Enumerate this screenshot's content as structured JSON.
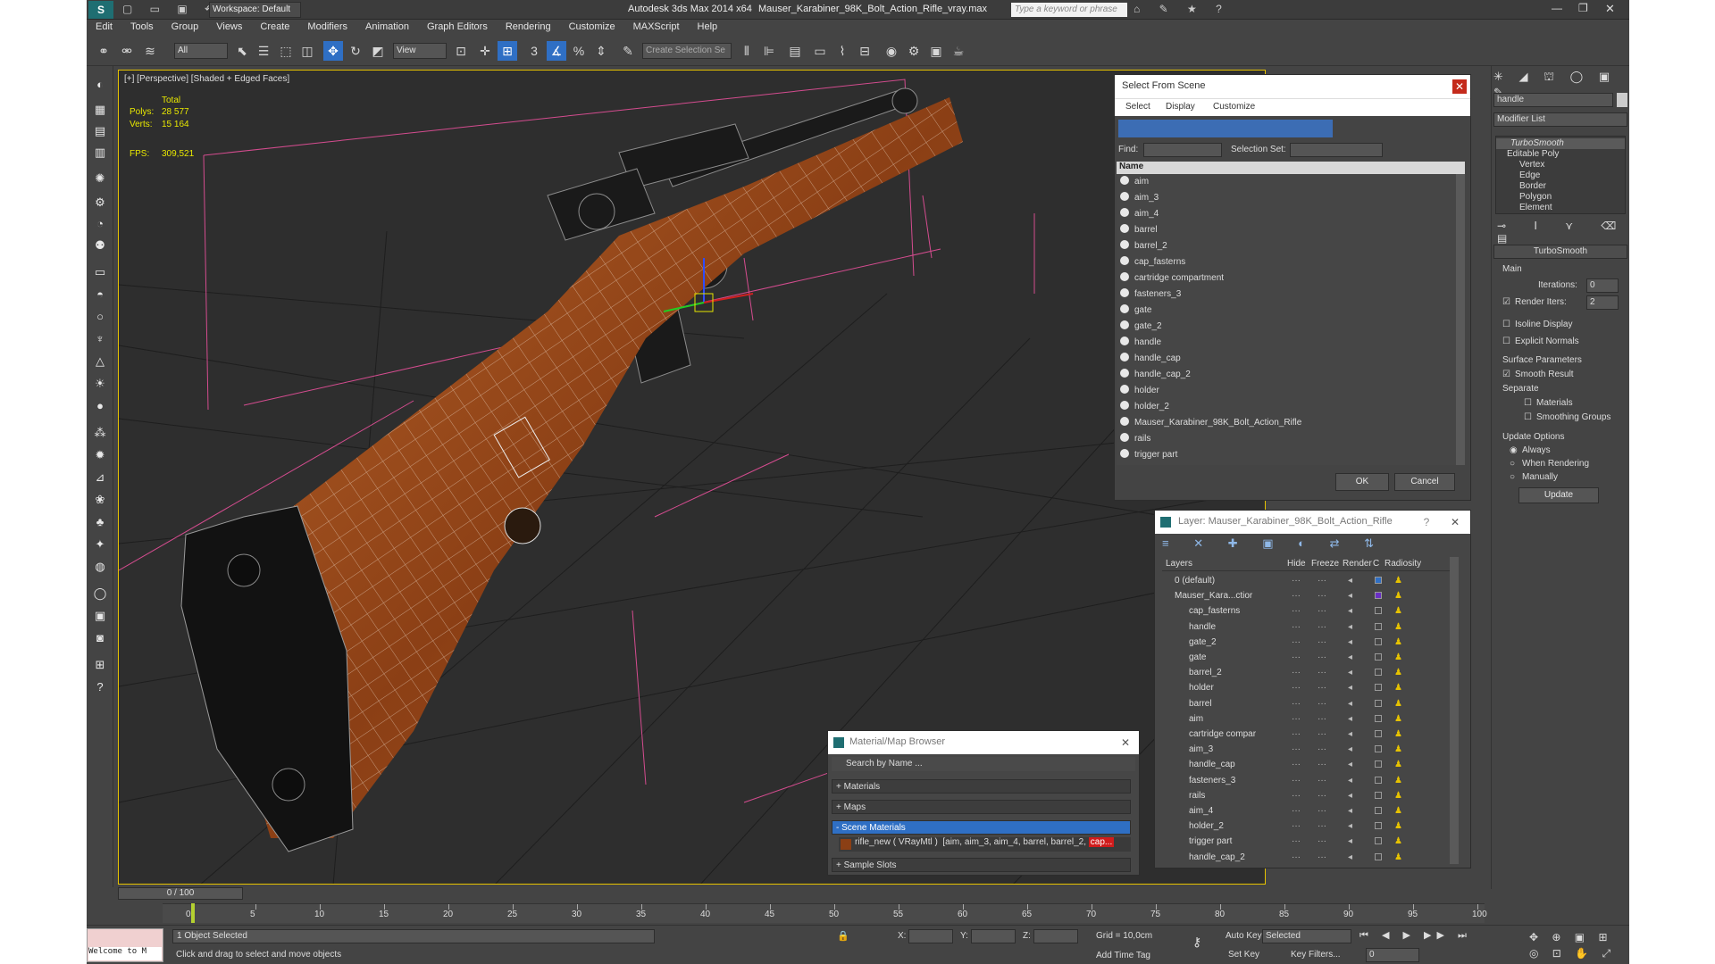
{
  "title": {
    "app": "Autodesk 3ds Max  2014 x64",
    "file": "Mauser_Karabiner_98K_Bolt_Action_Rifle_vray.max",
    "workspace": "Workspace: Default",
    "search_placeholder": "Type a keyword or phrase"
  },
  "menu": [
    "Edit",
    "Tools",
    "Group",
    "Views",
    "Create",
    "Modifiers",
    "Animation",
    "Graph Editors",
    "Rendering",
    "Customize",
    "MAXScript",
    "Help"
  ],
  "toolbar": {
    "filter": "All",
    "ref_coord": "View",
    "selection_set": "Create Selection Se"
  },
  "viewport": {
    "label": "[+] [Perspective] [Shaded + Edged Faces]",
    "stats_header": "Total",
    "polys_label": "Polys:",
    "polys_value": "28 577",
    "verts_label": "Verts:",
    "verts_value": "15 164",
    "fps_label": "FPS:",
    "fps_value": "309,521"
  },
  "select_from_scene": {
    "title": "Select From Scene",
    "tabs": [
      "Select",
      "Display",
      "Customize"
    ],
    "find_label": "Find:",
    "selection_set_label": "Selection Set:",
    "column": "Name",
    "items": [
      "aim",
      "aim_3",
      "aim_4",
      "barrel",
      "barrel_2",
      "cap_fasterns",
      "cartridge compartment",
      "fasteners_3",
      "gate",
      "gate_2",
      "handle",
      "handle_cap",
      "handle_cap_2",
      "holder",
      "holder_2",
      "Mauser_Karabiner_98K_Bolt_Action_Rifle",
      "rails",
      "trigger part"
    ],
    "ok": "OK",
    "cancel": "Cancel"
  },
  "layer_manager": {
    "title": "Layer: Mauser_Karabiner_98K_Bolt_Action_Rifle",
    "help": "?",
    "columns": [
      "Layers",
      "Hide",
      "Freeze",
      "Render",
      "C",
      "Radiosity"
    ],
    "layers": [
      "0 (default)",
      "Mauser_Kara...ctior"
    ],
    "objects": [
      "cap_fasterns",
      "handle",
      "gate_2",
      "gate",
      "barrel_2",
      "holder",
      "barrel",
      "aim",
      "cartridge compar",
      "aim_3",
      "handle_cap",
      "fasteners_3",
      "rails",
      "aim_4",
      "holder_2",
      "trigger part",
      "handle_cap_2"
    ]
  },
  "material_browser": {
    "title": "Material/Map Browser",
    "search_placeholder": "Search by Name ...",
    "groups": [
      "+ Materials",
      "+ Maps",
      "- Scene Materials",
      "+ Sample Slots"
    ],
    "material_name": "rifle_new  ( VRayMtl )",
    "material_refs": "[aim, aim_3, aim_4, barrel, barrel_2,",
    "material_refs_tail": "cap..."
  },
  "command_panel": {
    "name_field": "handle",
    "modifier_list": "Modifier List",
    "stack": [
      "TurboSmooth",
      "Editable Poly",
      "Vertex",
      "Edge",
      "Border",
      "Polygon",
      "Element"
    ],
    "rollout_title": "TurboSmooth",
    "main_label": "Main",
    "iterations_label": "Iterations:",
    "iterations_value": "0",
    "render_iters_label": "Render Iters:",
    "render_iters_value": "2",
    "isoline": "Isoline Display",
    "explicit_normals": "Explicit Normals",
    "surface_params": "Surface Parameters",
    "smooth_result": "Smooth Result",
    "separate": "Separate",
    "materials": "Materials",
    "smoothing_groups": "Smoothing Groups",
    "update_options": "Update Options",
    "always": "Always",
    "when_rendering": "When Rendering",
    "manually": "Manually",
    "update_button": "Update"
  },
  "timeline": {
    "frame": "0 / 100",
    "ticks": [
      "0",
      "5",
      "10",
      "15",
      "20",
      "25",
      "30",
      "35",
      "40",
      "45",
      "50",
      "55",
      "60",
      "65",
      "70",
      "75",
      "80",
      "85",
      "90",
      "95",
      "100"
    ]
  },
  "status": {
    "listener": "Welcome to M",
    "selected": "1 Object Selected",
    "prompt": "Click and drag to select and move objects",
    "x_label": "X:",
    "y_label": "Y:",
    "z_label": "Z:",
    "grid": "Grid = 10,0cm",
    "add_time_tag": "Add Time Tag",
    "auto_key": "Auto Key",
    "set_key": "Set Key",
    "selected_combo": "Selected",
    "key_filters": "Key Filters...",
    "frame_field": "0"
  },
  "colors": {
    "wood": "#a0521e",
    "viewport_bg": "#2e2e2e",
    "accent": "#2f6fc4"
  }
}
